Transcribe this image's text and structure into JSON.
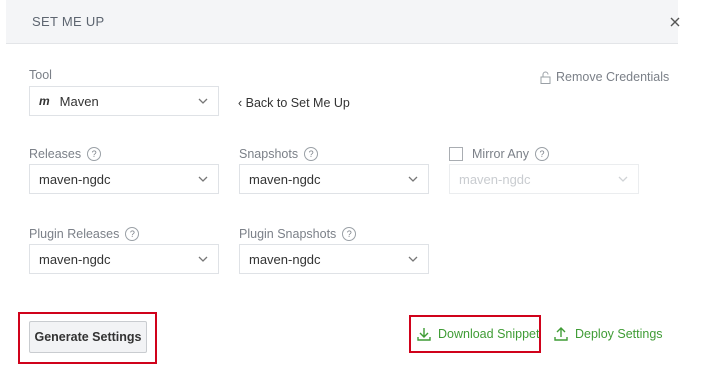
{
  "header": {
    "title": "SET ME UP",
    "close_icon": "close-icon"
  },
  "tool": {
    "label": "Tool",
    "value": "Maven",
    "icon": "m"
  },
  "back_link": "‹ Back to Set Me Up",
  "remove_credentials": "Remove Credentials",
  "releases": {
    "label": "Releases",
    "value": "maven-ngdc"
  },
  "snapshots": {
    "label": "Snapshots",
    "value": "maven-ngdc"
  },
  "mirror_any": {
    "label": "Mirror Any",
    "value": "maven-ngdc",
    "checked": false
  },
  "plugin_releases": {
    "label": "Plugin Releases",
    "value": "maven-ngdc"
  },
  "plugin_snapshots": {
    "label": "Plugin Snapshots",
    "value": "maven-ngdc"
  },
  "help_glyph": "?",
  "buttons": {
    "generate": "Generate Settings",
    "download": "Download Snippet",
    "deploy": "Deploy Settings"
  },
  "colors": {
    "accent_green": "#3f9c35",
    "highlight_red": "#d0021b"
  }
}
